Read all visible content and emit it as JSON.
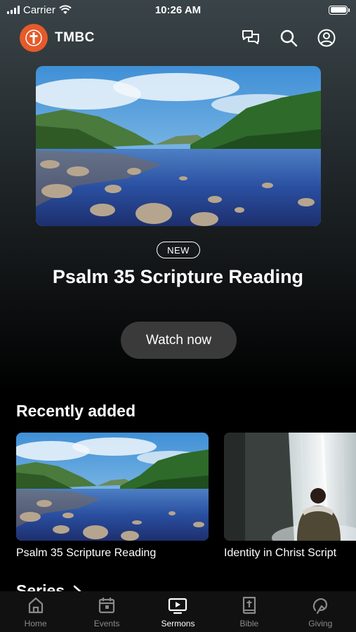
{
  "status_bar": {
    "carrier": "Carrier",
    "time": "10:26 AM"
  },
  "header": {
    "app_name": "TMBC"
  },
  "hero": {
    "badge": "NEW",
    "title": "Psalm 35 Scripture Reading",
    "button_label": "Watch now"
  },
  "recently_added": {
    "heading": "Recently added",
    "items": [
      {
        "title": "Psalm 35 Scripture Reading"
      },
      {
        "title": "Identity in Christ Script"
      }
    ]
  },
  "series": {
    "heading": "Series"
  },
  "tab_bar": {
    "tabs": [
      {
        "label": "Home",
        "icon": "home-icon"
      },
      {
        "label": "Events",
        "icon": "calendar-icon"
      },
      {
        "label": "Sermons",
        "icon": "tv-icon"
      },
      {
        "label": "Bible",
        "icon": "bible-icon"
      },
      {
        "label": "Giving",
        "icon": "giving-icon"
      }
    ],
    "active_tab": "Sermons"
  },
  "colors": {
    "brand": "#e55a2b",
    "button": "#3a3a3a",
    "tab_inactive": "#8a8a8a"
  }
}
